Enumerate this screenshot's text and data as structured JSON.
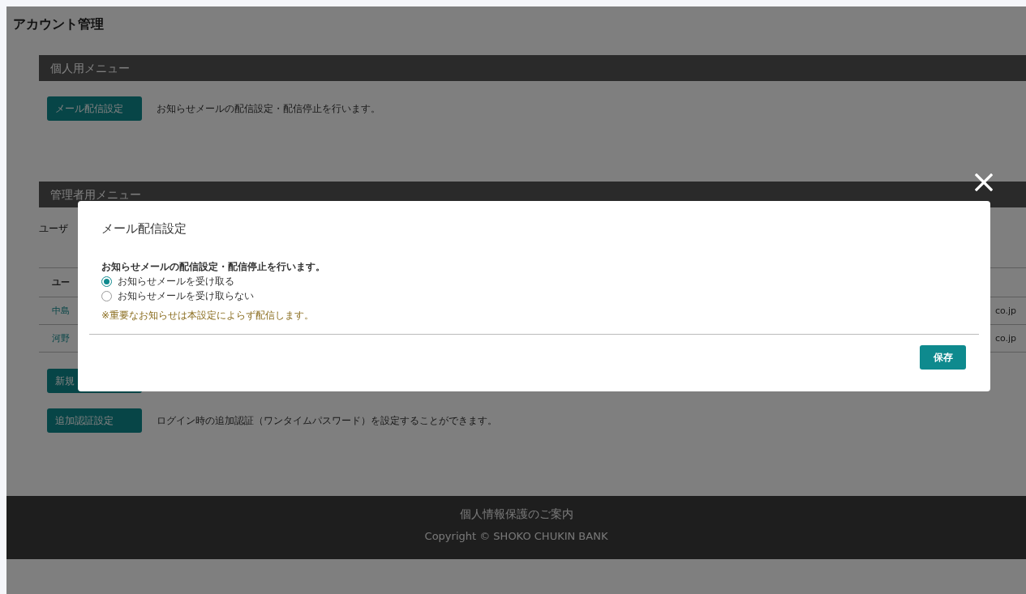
{
  "page": {
    "title": "アカウント管理"
  },
  "personal_menu": {
    "heading": "個人用メニュー",
    "items": [
      {
        "button": "メール配信設定",
        "description": "お知らせメールの配信設定・配信停止を行います。"
      }
    ]
  },
  "admin_menu": {
    "heading": "管理者用メニュー",
    "user_label": "ユーザ",
    "table": {
      "columns": [
        "ユー"
      ],
      "rows": [
        {
          "cells": [
            "中島",
            "co.jp"
          ]
        },
        {
          "cells": [
            "河野",
            "co.jp"
          ]
        }
      ]
    },
    "items": [
      {
        "button": "新規"
      },
      {
        "button": "追加認証設定",
        "description": "ログイン時の追加認証（ワンタイムパスワード）を設定することができます。"
      }
    ]
  },
  "modal": {
    "title": "メール配信設定",
    "prompt": "お知らせメールの配信設定・配信停止を行います。",
    "options": [
      {
        "label": "お知らせメールを受け取る",
        "selected": true
      },
      {
        "label": "お知らせメールを受け取らない",
        "selected": false
      }
    ],
    "note": "※重要なお知らせは本設定によらず配信します。",
    "save_button": "保存"
  },
  "footer": {
    "link": "個人情報保護のご案内",
    "copyright": "Copyright © SHOKO CHUKIN BANK"
  }
}
